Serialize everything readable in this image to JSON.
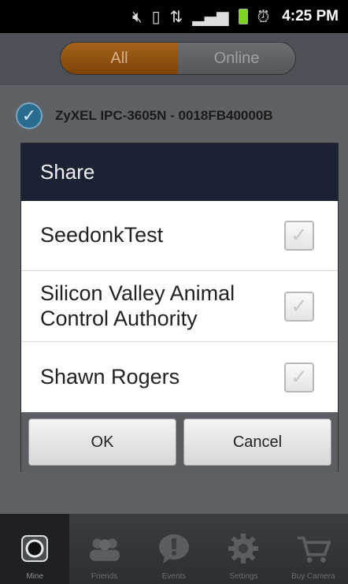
{
  "status_bar": {
    "icons": [
      "mute-icon",
      "vibrate-icon",
      "data-icon",
      "signal-icon",
      "battery-icon",
      "alarm-icon"
    ],
    "time": "4:25 PM"
  },
  "segmented": {
    "all_label": "All",
    "online_label": "Online",
    "selected": "All"
  },
  "device": {
    "name": "ZyXEL IPC-3605N - 0018FB40000B",
    "checked": true
  },
  "dialog": {
    "title": "Share",
    "items": [
      {
        "label": "SeedonkTest",
        "checked": false
      },
      {
        "label": "Silicon Valley Animal Control Authority",
        "checked": false
      },
      {
        "label": "Shawn Rogers",
        "checked": false
      }
    ],
    "ok_label": "OK",
    "cancel_label": "Cancel"
  },
  "bottom_nav": {
    "items": [
      {
        "label": "Mine",
        "icon": "camera-icon",
        "active": true
      },
      {
        "label": "Friends",
        "icon": "friends-icon",
        "active": false
      },
      {
        "label": "Events",
        "icon": "events-icon",
        "active": false
      },
      {
        "label": "Settings",
        "icon": "gear-icon",
        "active": false
      },
      {
        "label": "Buy Camera",
        "icon": "cart-icon",
        "active": false
      }
    ]
  },
  "colors": {
    "accent_orange": "#9a5a18",
    "dialog_header": "#1b2233",
    "device_check": "#2a6b90"
  }
}
